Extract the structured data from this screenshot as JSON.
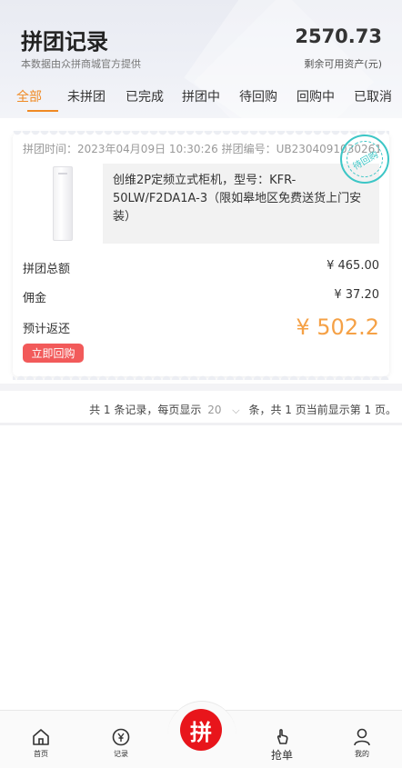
{
  "header": {
    "title": "拼团记录",
    "subtitle": "本数据由众拼商城官方提供",
    "balance": "2570.73",
    "balance_label": "剩余可用资产(元)"
  },
  "tabs": [
    {
      "label": "全部",
      "active": true
    },
    {
      "label": "未拼团",
      "active": false
    },
    {
      "label": "已完成",
      "active": false
    },
    {
      "label": "拼团中",
      "active": false
    },
    {
      "label": "待回购",
      "active": false
    },
    {
      "label": "回购中",
      "active": false
    },
    {
      "label": "已取消",
      "active": false
    }
  ],
  "order": {
    "meta": "拼团时间：2023年04月09日 10:30:26 拼团编号：UB230409103026186",
    "stamp": "待回购",
    "product_name": "创维2P定频立式柜机，型号：KFR-50LW/F2DA1A-3（限如皋地区免费送货上门安装）",
    "rows": [
      {
        "label": "拼团总额",
        "value": "¥ 465.00"
      },
      {
        "label": "佣金",
        "value": "¥ 37.20"
      }
    ],
    "return_label": "预计返还",
    "return_value": "¥ 502.2",
    "button_label": "立即回购"
  },
  "pager": {
    "prefix": "共 1 条记录，每页显示",
    "page_size": "20",
    "suffix": "条，共 1 页当前显示第 1 页。"
  },
  "tabbar": {
    "home": "首页",
    "records": "记录",
    "center": "拼",
    "grab": "抢单",
    "mine": "我的"
  },
  "colors": {
    "accent": "#f08a24",
    "price": "#f5a146",
    "button": "#f25a5a",
    "stamp": "#3cc6c6",
    "center": "#e8151b"
  }
}
